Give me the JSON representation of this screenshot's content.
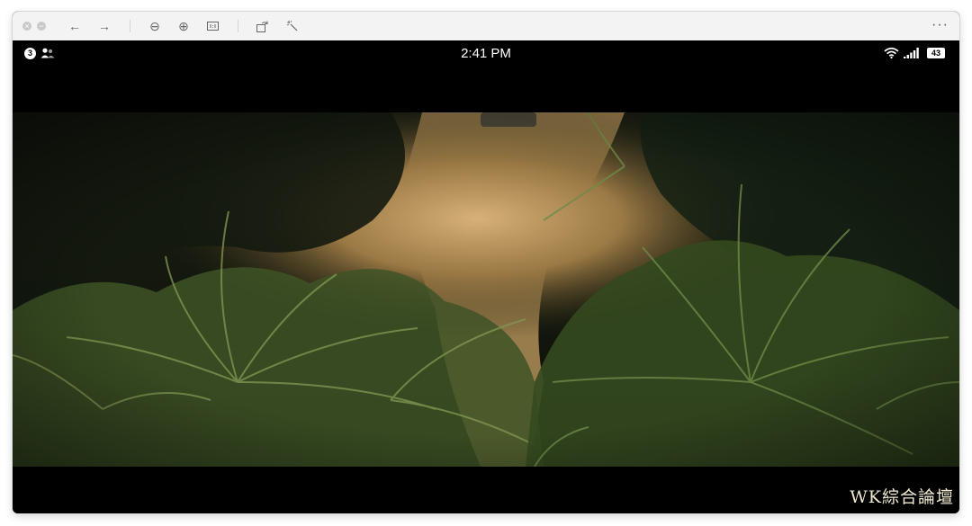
{
  "toolbar": {
    "close_glyph": "×",
    "minimize_glyph": "−",
    "back_glyph": "←",
    "forward_glyph": "→",
    "zoom_out_glyph": "⊖",
    "zoom_in_glyph": "⊕",
    "more_glyph": "···",
    "icons": [
      "close-icon",
      "minimize-icon",
      "back-arrow-icon",
      "forward-arrow-icon",
      "zoom-out-icon",
      "zoom-in-icon",
      "actual-size-icon",
      "rotate-icon",
      "markup-icon",
      "more-icon"
    ]
  },
  "status_bar": {
    "time": "2:41 PM",
    "notification_count": "3",
    "battery": "43",
    "icons": [
      "persons-icon",
      "wifi-icon",
      "cellular-signal-icon",
      "battery-icon"
    ]
  },
  "video": {
    "subject": "aerial view of palm trees over a dirt road"
  },
  "watermark": {
    "text": "WK綜合論壇"
  },
  "colors": {
    "toolbar_bg": "#f3f3f3",
    "screen_bg": "#000000",
    "status_text": "#ffffff",
    "watermark": "#f1e9cf"
  }
}
